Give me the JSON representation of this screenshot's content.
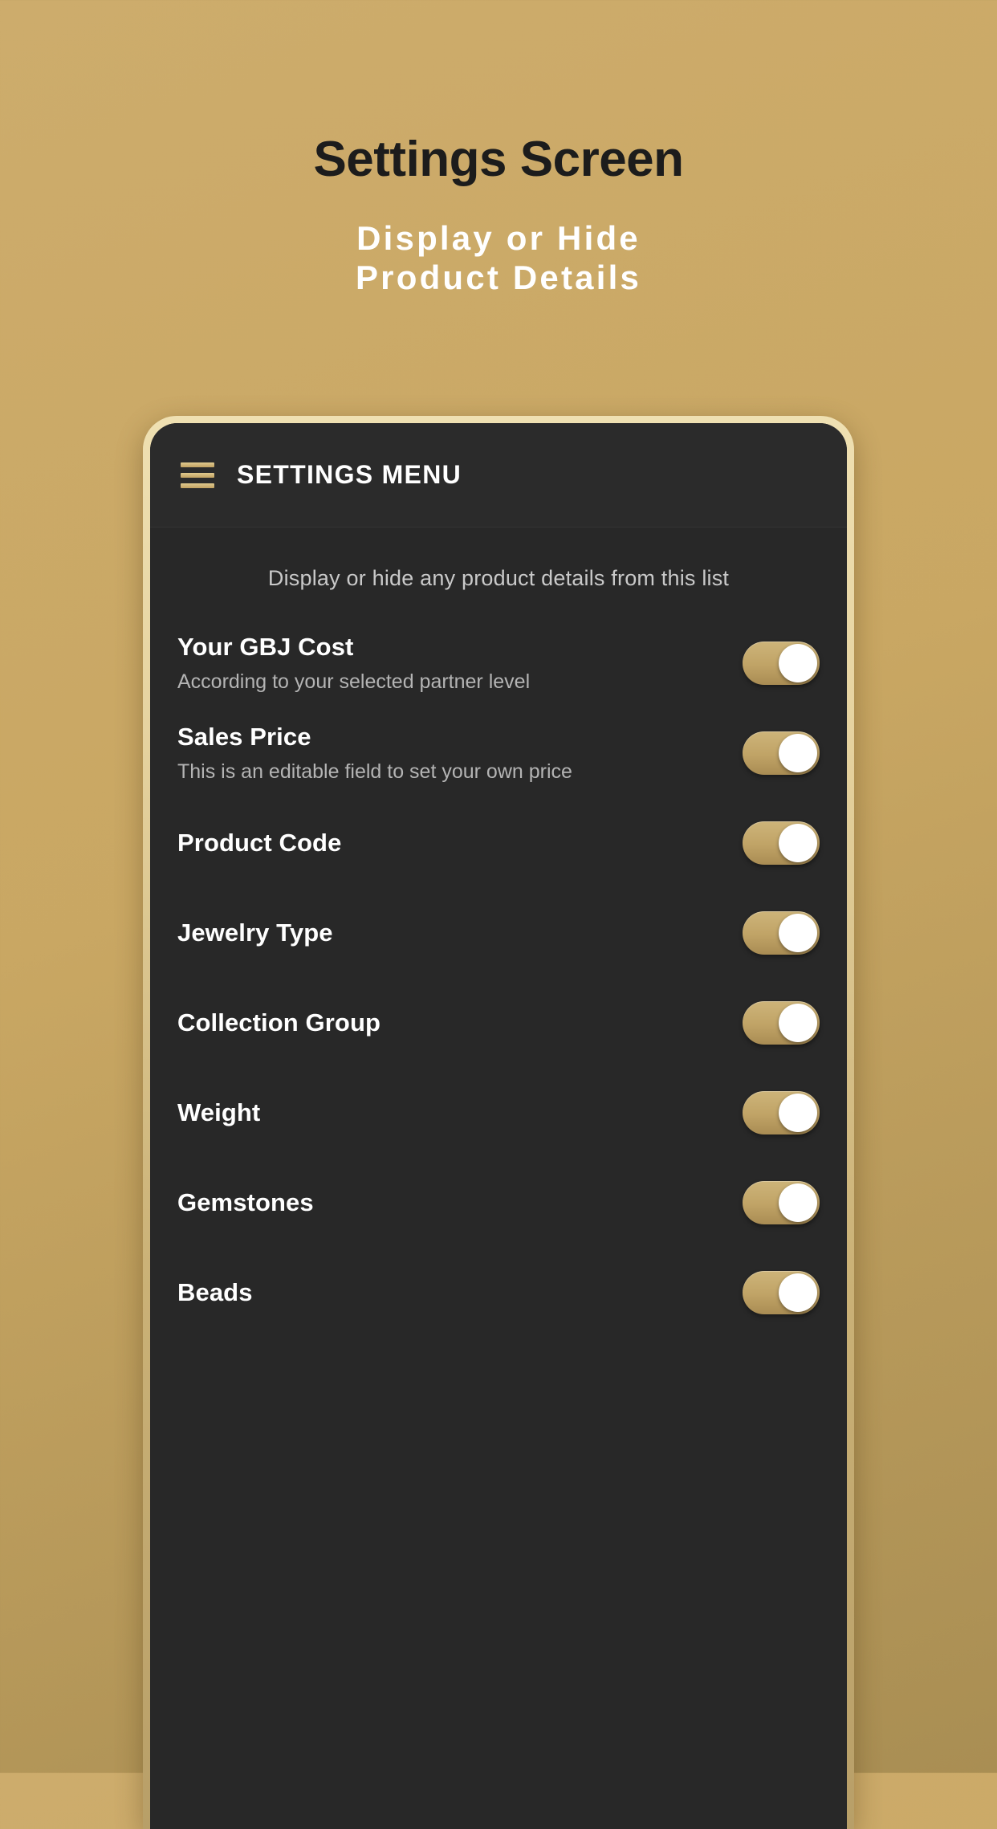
{
  "promo": {
    "title": "Settings Screen",
    "subtitle_line1": "Display or Hide",
    "subtitle_line2": "Product Details"
  },
  "colors": {
    "background_gold": "#cdac6c",
    "phone_frame": "#e6d3a0",
    "screen_dark": "#282828",
    "accent_gold": "#c0a366",
    "knob_white": "#ffffff",
    "title_dark": "#1c1c1c",
    "subtitle_white": "#ffffff",
    "hint_gray": "#c9c9c9",
    "desc_gray": "#b4b4b4"
  },
  "app": {
    "menu_icon": "hamburger-icon",
    "appbar_title": "SETTINGS MENU",
    "hint": "Display or hide any product details from this list"
  },
  "settings_rows": [
    {
      "label": "Your GBJ Cost",
      "description": "According to your selected partner level",
      "toggle_state": "on"
    },
    {
      "label": "Sales Price",
      "description": "This is an editable field to set your own price",
      "toggle_state": "on"
    },
    {
      "label": "Product Code",
      "description": "",
      "toggle_state": "on"
    },
    {
      "label": "Jewelry Type",
      "description": "",
      "toggle_state": "on"
    },
    {
      "label": "Collection Group",
      "description": "",
      "toggle_state": "on"
    },
    {
      "label": "Weight",
      "description": "",
      "toggle_state": "on"
    },
    {
      "label": "Gemstones",
      "description": "",
      "toggle_state": "on"
    },
    {
      "label": "Beads",
      "description": "",
      "toggle_state": "on"
    }
  ]
}
